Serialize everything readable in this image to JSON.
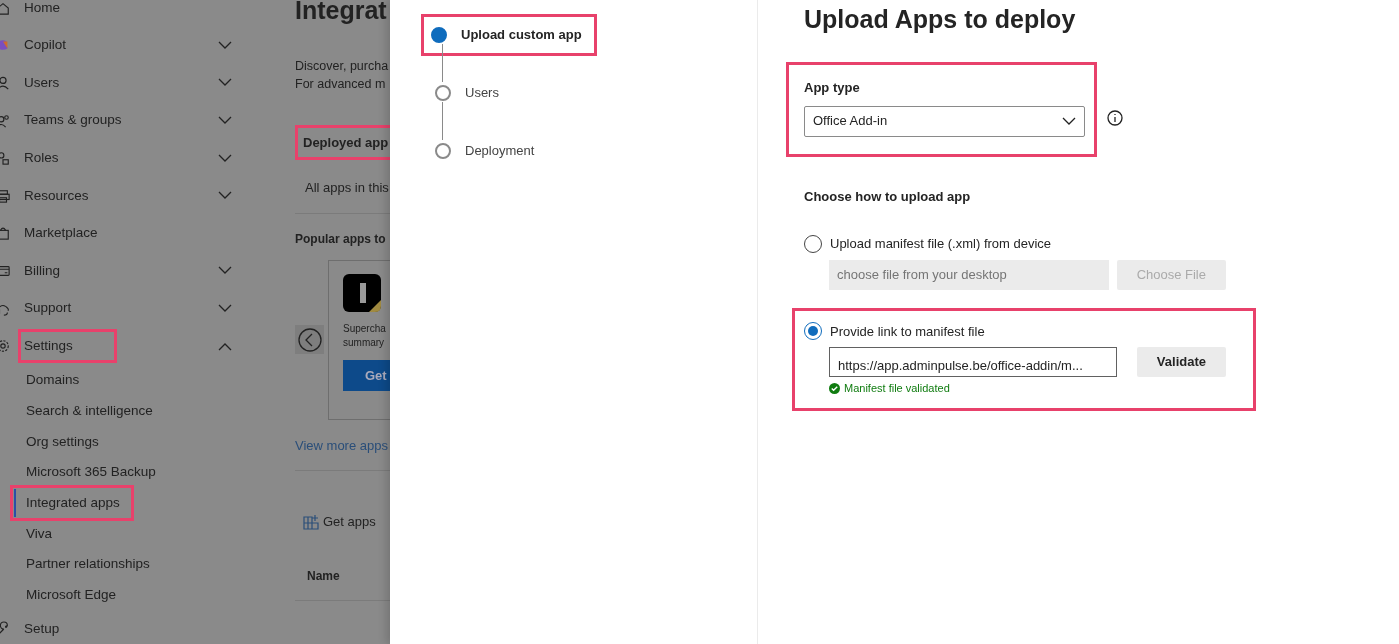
{
  "sidebar": {
    "items": [
      {
        "label": "Home"
      },
      {
        "label": "Copilot",
        "expanded": false
      },
      {
        "label": "Users",
        "expanded": false
      },
      {
        "label": "Teams & groups",
        "expanded": false
      },
      {
        "label": "Roles",
        "expanded": false
      },
      {
        "label": "Resources",
        "expanded": false
      },
      {
        "label": "Marketplace"
      },
      {
        "label": "Billing",
        "expanded": false
      },
      {
        "label": "Support",
        "expanded": false
      },
      {
        "label": "Settings",
        "expanded": true,
        "highlighted": true,
        "children": [
          {
            "label": "Domains",
            "selected": false,
            "highlighted": false
          },
          {
            "label": "Search & intelligence",
            "selected": false,
            "highlighted": false
          },
          {
            "label": "Org settings",
            "selected": false,
            "highlighted": false
          },
          {
            "label": "Microsoft 365 Backup",
            "selected": false,
            "highlighted": false
          },
          {
            "label": "Integrated apps",
            "selected": true,
            "highlighted": true
          },
          {
            "label": "Viva",
            "selected": false,
            "highlighted": false
          },
          {
            "label": "Partner relationships",
            "selected": false,
            "highlighted": false
          },
          {
            "label": "Microsoft Edge",
            "selected": false,
            "highlighted": false
          }
        ]
      },
      {
        "label": "Setup"
      }
    ]
  },
  "background_page": {
    "title": "Integrat",
    "description": [
      "Discover, purcha",
      "For advanced m"
    ],
    "tab": {
      "label": "Deployed app",
      "highlighted": true
    },
    "tab_text": "All apps in this",
    "popular_heading": "Popular apps to",
    "app_card": {
      "description": [
        "Supercha",
        "summary"
      ],
      "button": "Get"
    },
    "view_more_link": "View more apps",
    "get_apps_button": "Get apps",
    "table_header": "Name"
  },
  "steps": [
    {
      "label": "Upload custom app",
      "selected": true,
      "highlighted": true
    },
    {
      "label": "Users",
      "selected": false,
      "highlighted": false
    },
    {
      "label": "Deployment",
      "selected": false,
      "highlighted": false
    }
  ],
  "form": {
    "title": "Upload Apps to deploy",
    "app_type": {
      "label": "App type",
      "value": "Office Add-in",
      "highlighted": true
    },
    "upload_heading": "Choose how to upload app",
    "options": [
      {
        "kind": "file",
        "label": "Upload manifest file (.xml) from device",
        "selected": false,
        "highlighted": false,
        "placeholder": "choose file from your desktop",
        "button": "Choose File",
        "disabled": true
      },
      {
        "kind": "link",
        "label": "Provide link to manifest file",
        "selected": true,
        "highlighted": true,
        "value": "https://app.adminpulse.be/office-addin/m...",
        "button": "Validate",
        "disabled": false,
        "status": "Manifest file validated"
      }
    ]
  }
}
